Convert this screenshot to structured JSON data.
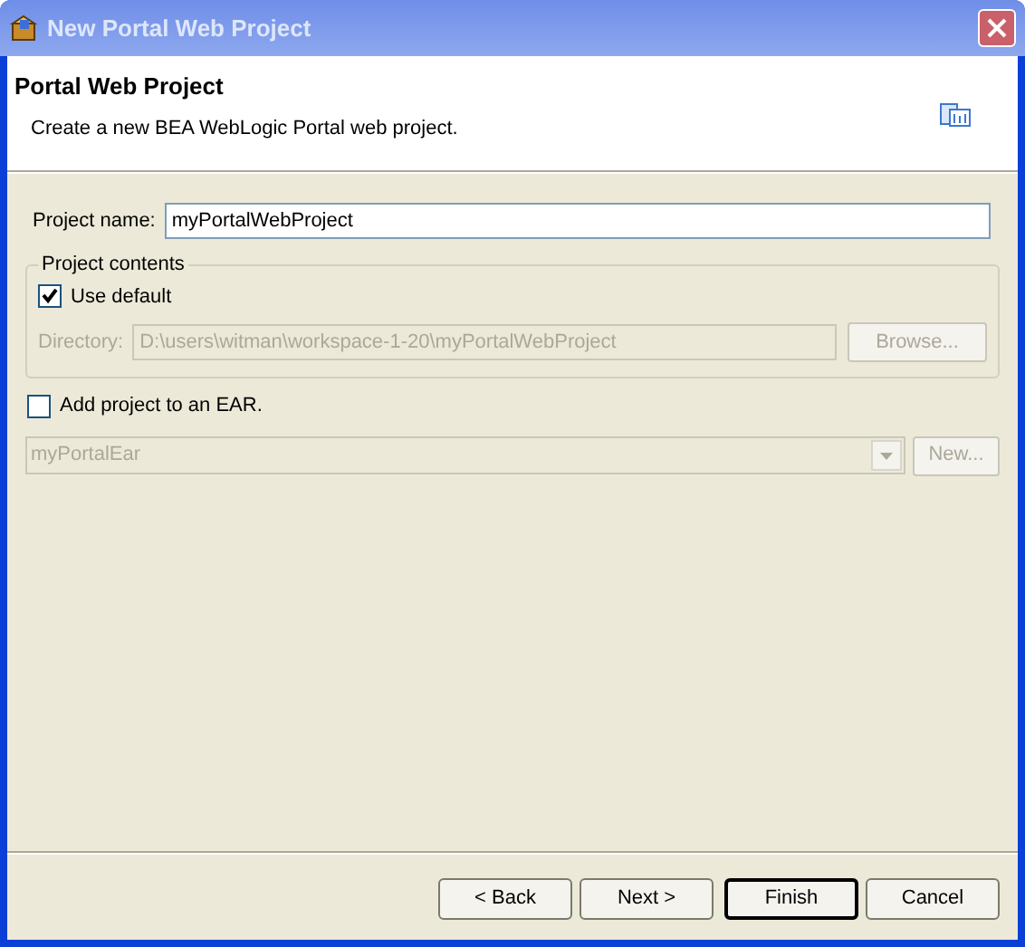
{
  "window": {
    "title": "New Portal Web Project"
  },
  "header": {
    "title": "Portal Web Project",
    "description": "Create a new BEA WebLogic Portal web project."
  },
  "project_name": {
    "label": "Project name:",
    "value": "myPortalWebProject"
  },
  "project_contents": {
    "legend": "Project contents",
    "use_default": {
      "label": "Use default",
      "checked": true
    },
    "directory": {
      "label": "Directory:",
      "value": "D:\\users\\witman\\workspace-1-20\\myPortalWebProject",
      "disabled": true
    },
    "browse_button": {
      "label": "Browse...",
      "disabled": true
    }
  },
  "add_to_ear": {
    "label": "Add project to an EAR.",
    "checked": false
  },
  "ear_combo": {
    "value": "myPortalEar",
    "disabled": true
  },
  "new_button": {
    "label": "New...",
    "disabled": true
  },
  "buttons": [
    {
      "label": "< Back",
      "default": false
    },
    {
      "label": "Next >",
      "default": false
    },
    {
      "label": "Finish",
      "default": true
    },
    {
      "label": "Cancel",
      "default": false
    }
  ]
}
